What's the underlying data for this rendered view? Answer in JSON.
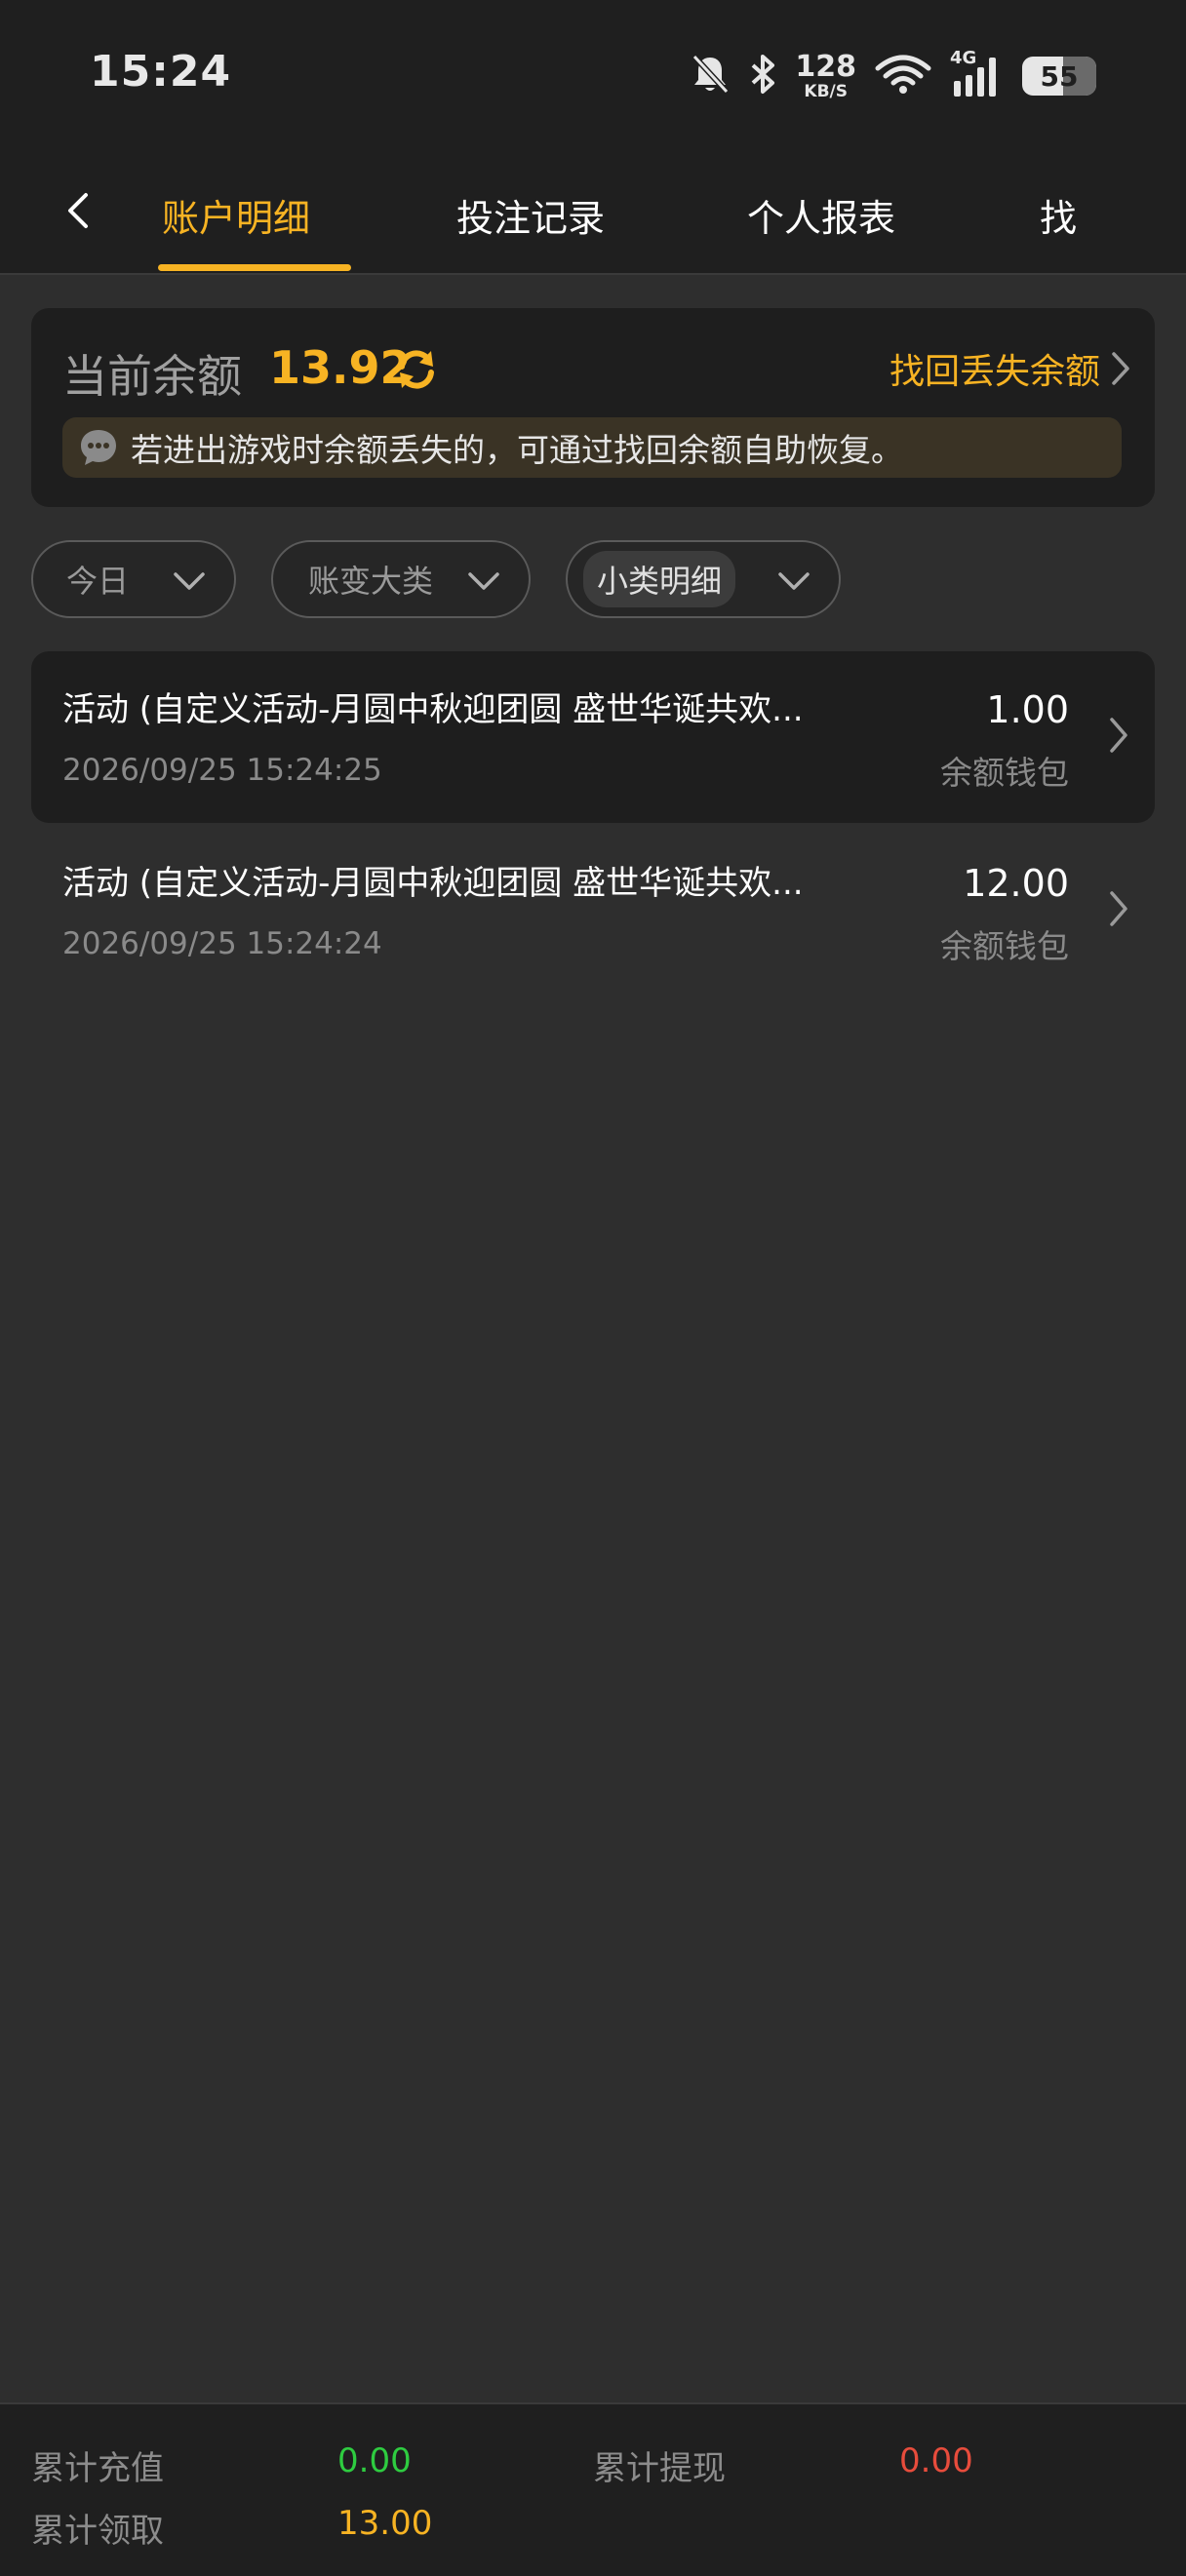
{
  "status_bar": {
    "time": "15:24",
    "net_speed_value": "128",
    "net_speed_unit": "KB/S",
    "network_type": "4G",
    "battery_level": "55",
    "battery_fraction": 0.55
  },
  "nav": {
    "tabs": [
      {
        "label": "账户明细",
        "active": true
      },
      {
        "label": "投注记录",
        "active": false
      },
      {
        "label": "个人报表",
        "active": false
      },
      {
        "label": "找",
        "active": false
      }
    ]
  },
  "balance": {
    "label": "当前余额",
    "value": "13.92",
    "recover_label": "找回丢失余额",
    "notice": "若进出游戏时余额丢失的，可通过找回余额自助恢复。"
  },
  "filters": [
    {
      "label": "今日"
    },
    {
      "label": "账变大类"
    },
    {
      "label": "小类明细"
    }
  ],
  "records": [
    {
      "title": "活动 (自定义活动-月圆中秋迎团圆 盛世华诞共欢...",
      "time": "2026/09/25 15:24:25",
      "amount": "1.00",
      "wallet": "余额钱包"
    },
    {
      "title": "活动 (自定义活动-月圆中秋迎团圆 盛世华诞共欢...",
      "time": "2026/09/25 15:24:24",
      "amount": "12.00",
      "wallet": "余额钱包"
    }
  ],
  "summary": {
    "deposit_label": "累计充值",
    "deposit_value": "0.00",
    "withdraw_label": "累计提现",
    "withdraw_value": "0.00",
    "claim_label": "累计领取",
    "claim_value": "13.00"
  },
  "colors": {
    "accent": "#f7b323",
    "positive": "#2ecc40",
    "negative": "#e74c3c",
    "background": "#2e2e2e"
  }
}
